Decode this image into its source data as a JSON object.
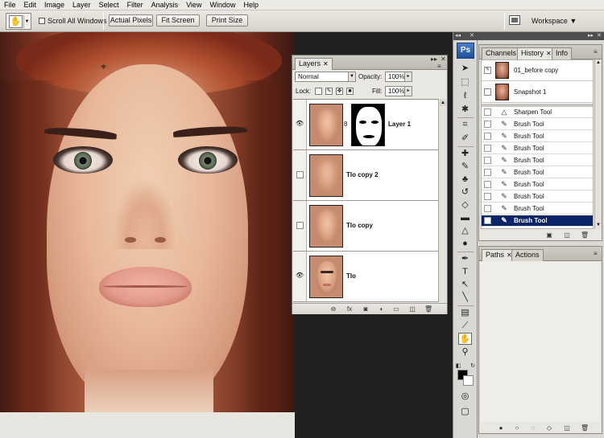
{
  "menu": [
    "File",
    "Edit",
    "Image",
    "Layer",
    "Select",
    "Filter",
    "Analysis",
    "View",
    "Window",
    "Help"
  ],
  "options_bar": {
    "scroll_all_windows": "Scroll All Windows",
    "actual_pixels": "Actual Pixels",
    "fit_screen": "Fit Screen",
    "print_size": "Print Size",
    "workspace": "Workspace ▼"
  },
  "layers_panel": {
    "tab": "Layers",
    "blend_mode": "Normal",
    "opacity_label": "Opacity:",
    "opacity_value": "100%",
    "lock_label": "Lock:",
    "fill_label": "Fill:",
    "fill_value": "100%",
    "layers": [
      {
        "name": "Layer 1",
        "visible": true,
        "has_mask": true
      },
      {
        "name": "Tlo copy 2",
        "visible": false,
        "has_mask": false
      },
      {
        "name": "Tlo copy",
        "visible": false,
        "has_mask": false
      },
      {
        "name": "Tlo",
        "visible": true,
        "has_mask": false
      }
    ]
  },
  "tools_panel": {
    "logo": "Ps"
  },
  "history_panel": {
    "tabs": [
      "Channels",
      "History",
      "Info"
    ],
    "active_tab": "History",
    "snapshots": [
      "01_before copy",
      "Snapshot 1"
    ],
    "states": [
      "Sharpen Tool",
      "Brush Tool",
      "Brush Tool",
      "Brush Tool",
      "Brush Tool",
      "Brush Tool",
      "Brush Tool",
      "Brush Tool",
      "Brush Tool",
      "Brush Tool"
    ],
    "selected_state_index": 9
  },
  "paths_panel": {
    "tabs": [
      "Paths",
      "Actions"
    ]
  }
}
